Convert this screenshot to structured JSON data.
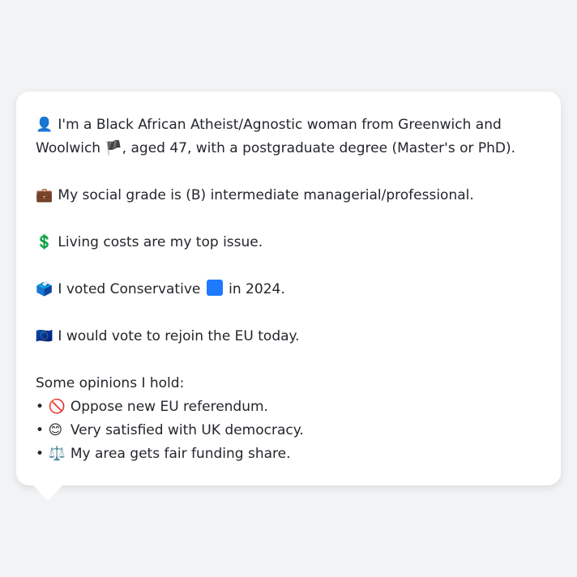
{
  "card": {
    "line1_icon": "👤",
    "line1_text_a": "I'm a Black African Atheist/Agnostic woman from Greenwich and Woolwich",
    "line1_flag": "🏴",
    "line1_text_b": ", aged 47, with a postgraduate degree (Master's or PhD).",
    "line2_icon": "💼",
    "line2_text": "My social grade is (B) intermediate managerial/professional.",
    "line3_icon": "💲",
    "line3_text": "Living costs are my top issue.",
    "line4_icon": "🗳️",
    "line4_text_a": "I voted Conservative",
    "line4_text_b": "in 2024.",
    "line5_icon": "🇪🇺",
    "line5_text": "I would vote to rejoin the EU today.",
    "opinions_heading": "Some opinions I hold:",
    "opinions": [
      {
        "bullet": "•",
        "icon": "🚫",
        "text": "Oppose new EU referendum."
      },
      {
        "bullet": "•",
        "icon": "😊",
        "text": "Very satisfied with UK democracy."
      },
      {
        "bullet": "•",
        "icon": "⚖️",
        "text": "My area gets fair funding share."
      }
    ],
    "party_color": "#1e7bff"
  }
}
